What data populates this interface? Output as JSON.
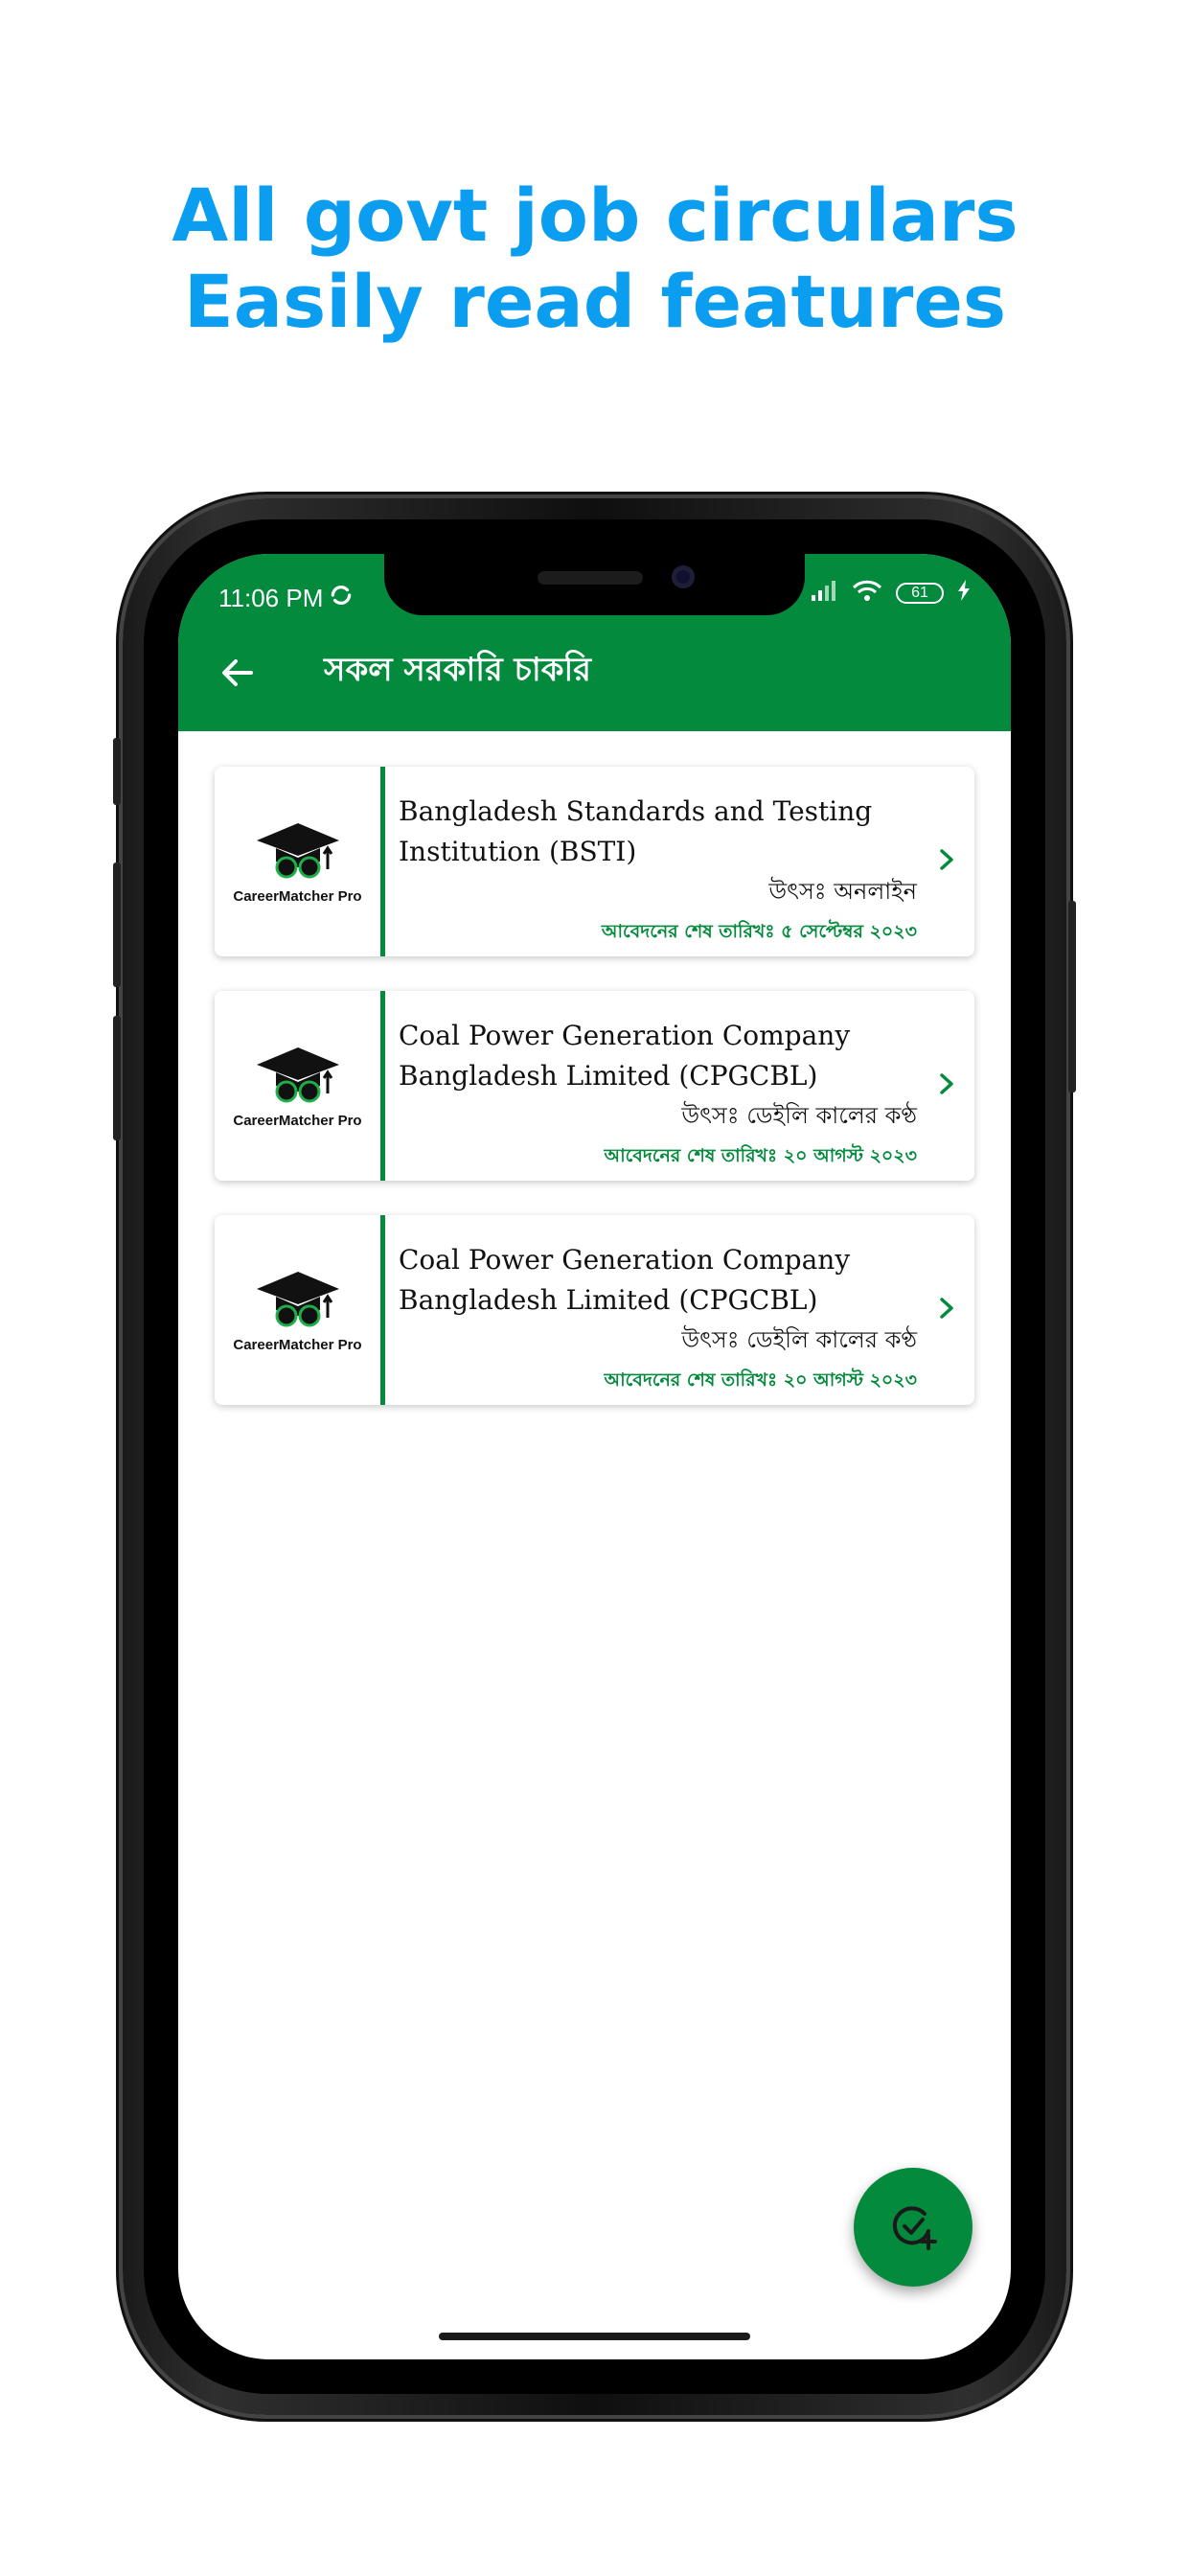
{
  "headline": {
    "line1": "All govt job circulars",
    "line2": "Easily read features"
  },
  "status_bar": {
    "time": "11:06 PM",
    "battery": "61"
  },
  "toolbar": {
    "title": "সকল সরকারি চাকরি"
  },
  "colors": {
    "accent": "#048a3d",
    "headline": "#0a9df0"
  },
  "jobs": [
    {
      "logo_text": "CareerMatcher Pro",
      "title": "Bangladesh Standards and Testing Institution (BSTI)",
      "source": "উৎসঃ অনলাইন",
      "deadline": "আবেদনের শেষ তারিখঃ ৫ সেপ্টেম্বর ২০২৩"
    },
    {
      "logo_text": "CareerMatcher Pro",
      "title": "Coal Power Generation Company Bangladesh Limited (CPGCBL)",
      "source": "উৎসঃ ডেইলি কালের কণ্ঠ",
      "deadline": "আবেদনের শেষ তারিখঃ ২০ আগস্ট ২০২৩"
    },
    {
      "logo_text": "CareerMatcher Pro",
      "title": "Coal Power Generation Company Bangladesh Limited (CPGCBL)",
      "source": "উৎসঃ ডেইলি কালের কণ্ঠ",
      "deadline": "আবেদনের শেষ তারিখঃ ২০ আগস্ট ২০২৩"
    }
  ],
  "icons": {
    "back": "arrow-left-icon",
    "chevron": "chevron-right-icon",
    "fab": "check-circle-add-icon"
  }
}
